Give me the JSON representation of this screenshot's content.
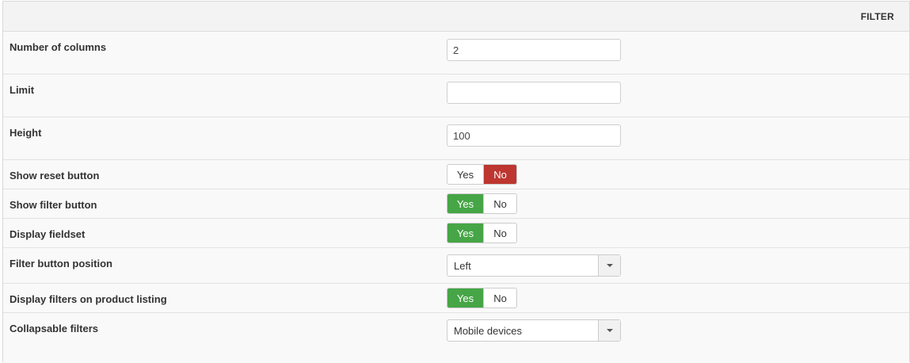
{
  "panel": {
    "title": "FILTER"
  },
  "fields": {
    "columns": {
      "label": "Number of columns",
      "value": "2"
    },
    "limit": {
      "label": "Limit",
      "value": ""
    },
    "height": {
      "label": "Height",
      "value": "100"
    },
    "show_reset": {
      "label": "Show reset button",
      "yes": "Yes",
      "no": "No",
      "selected": "No"
    },
    "show_filter": {
      "label": "Show filter button",
      "yes": "Yes",
      "no": "No",
      "selected": "Yes"
    },
    "display_fieldset": {
      "label": "Display fieldset",
      "yes": "Yes",
      "no": "No",
      "selected": "Yes"
    },
    "filter_position": {
      "label": "Filter button position",
      "value": "Left"
    },
    "display_on_listing": {
      "label": "Display filters on product listing",
      "yes": "Yes",
      "no": "No",
      "selected": "Yes"
    },
    "collapsable": {
      "label": "Collapsable filters",
      "value": "Mobile devices"
    }
  },
  "colors": {
    "yes_active": "#46a546",
    "no_active": "#bd362f"
  }
}
